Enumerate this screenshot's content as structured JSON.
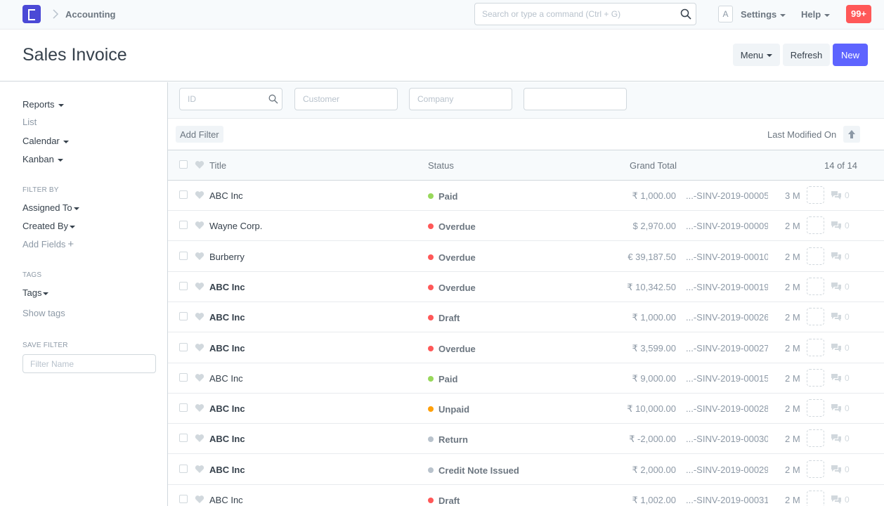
{
  "navbar": {
    "breadcrumb": "Accounting",
    "search_placeholder": "Search or type a command (Ctrl + G)",
    "avatar_letter": "A",
    "settings_label": "Settings",
    "help_label": "Help",
    "notifications_badge": "99+"
  },
  "page": {
    "title": "Sales Invoice",
    "menu_label": "Menu",
    "refresh_label": "Refresh",
    "new_label": "New"
  },
  "sidebar": {
    "reports": "Reports",
    "list": "List",
    "calendar": "Calendar",
    "kanban": "Kanban",
    "filter_by_heading": "FILTER BY",
    "assigned_to": "Assigned To",
    "created_by": "Created By",
    "add_fields": "Add Fields",
    "tags_heading": "TAGS",
    "tags": "Tags",
    "show_tags": "Show tags",
    "save_filter_heading": "SAVE FILTER",
    "filter_name_placeholder": "Filter Name"
  },
  "filters": {
    "id_placeholder": "ID",
    "customer_placeholder": "Customer",
    "company_placeholder": "Company",
    "add_filter": "Add Filter",
    "sort_label": "Last Modified On"
  },
  "list": {
    "col_title": "Title",
    "col_status": "Status",
    "col_total": "Grand Total",
    "count": "14 of 14",
    "status_colors": {
      "Paid": "#98d85b",
      "Overdue": "#ff5858",
      "Draft": "#ff5858",
      "Unpaid": "#ffa00a",
      "Return": "#b8c2cc",
      "Credit Note Issued": "#b8c2cc"
    },
    "rows": [
      {
        "title": "ABC Inc",
        "bold": false,
        "status": "Paid",
        "total": "₹ 1,000.00",
        "name": "...-SINV-2019-00005",
        "modified": "3 M",
        "comments": "0"
      },
      {
        "title": "Wayne Corp.",
        "bold": false,
        "status": "Overdue",
        "total": "$ 2,970.00",
        "name": "...-SINV-2019-00009",
        "modified": "2 M",
        "comments": "0"
      },
      {
        "title": "Burberry",
        "bold": false,
        "status": "Overdue",
        "total": "€ 39,187.50",
        "name": "...-SINV-2019-00010",
        "modified": "2 M",
        "comments": "0"
      },
      {
        "title": "ABC Inc",
        "bold": true,
        "status": "Overdue",
        "total": "₹ 10,342.50",
        "name": "...-SINV-2019-00019",
        "modified": "2 M",
        "comments": "0"
      },
      {
        "title": "ABC Inc",
        "bold": true,
        "status": "Draft",
        "total": "₹ 1,000.00",
        "name": "...-SINV-2019-00026",
        "modified": "2 M",
        "comments": "0"
      },
      {
        "title": "ABC Inc",
        "bold": true,
        "status": "Overdue",
        "total": "₹ 3,599.00",
        "name": "...-SINV-2019-00027",
        "modified": "2 M",
        "comments": "0"
      },
      {
        "title": "ABC Inc",
        "bold": false,
        "status": "Paid",
        "total": "₹ 9,000.00",
        "name": "...-SINV-2019-00015",
        "modified": "2 M",
        "comments": "0"
      },
      {
        "title": "ABC Inc",
        "bold": true,
        "status": "Unpaid",
        "total": "₹ 10,000.00",
        "name": "...-SINV-2019-00028",
        "modified": "2 M",
        "comments": "0"
      },
      {
        "title": "ABC Inc",
        "bold": true,
        "status": "Return",
        "total": "₹ -2,000.00",
        "name": "...-SINV-2019-00030",
        "modified": "2 M",
        "comments": "0"
      },
      {
        "title": "ABC Inc",
        "bold": true,
        "status": "Credit Note Issued",
        "total": "₹ 2,000.00",
        "name": "...-SINV-2019-00029",
        "modified": "2 M",
        "comments": "0"
      },
      {
        "title": "ABC Inc",
        "bold": false,
        "status": "Draft",
        "total": "₹ 1,002.00",
        "name": "...-SINV-2019-00031",
        "modified": "2 M",
        "comments": "0"
      }
    ]
  }
}
